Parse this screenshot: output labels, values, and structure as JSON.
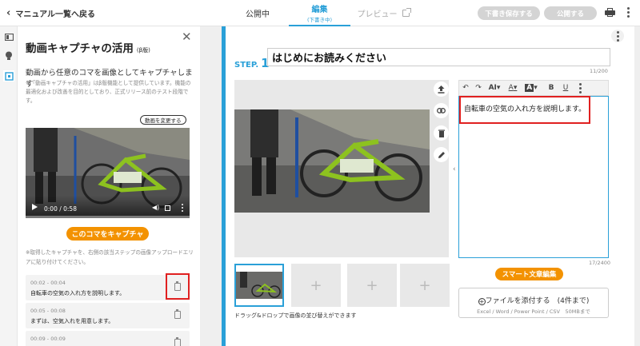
{
  "header": {
    "back_label": "マニュアル一覧へ戻る",
    "tabs": [
      {
        "label": "公開中",
        "sub": ""
      },
      {
        "label": "編集",
        "sub": "(下書き中)"
      },
      {
        "label": "プレビュー",
        "sub": ""
      }
    ],
    "save_draft_label": "下書き保存する",
    "publish_label": "公開する",
    "icons": [
      "chevron-left-icon",
      "external-link-icon",
      "printer-icon",
      "more-vert-icon"
    ]
  },
  "rail": {
    "icons": [
      "book-icon",
      "lightbulb-icon",
      "capture-icon"
    ]
  },
  "capture_panel": {
    "title": "動画キャプチャの活用",
    "beta": "(β版)",
    "lead": "動画から任意のコマを画像としてキャプチャします",
    "note": "※「動画キャプチャの活用」はβ版機能として提供しています。機能の最適化および改善を目的としており、正式リリース前のテスト段階です。",
    "change_video_label": "動画を変更する",
    "video_time": "0:00 / 0:58",
    "capture_button_label": "このコマをキャプチャ",
    "capture_note": "※取得したキャプチャを、右側の該当ステップの画像アップロードエリアに貼り付けてください。",
    "clips": [
      {
        "time": "00:02 - 00:04",
        "text": "自転車の空気の入れ方を説明します。"
      },
      {
        "time": "00:05 - 00:08",
        "text": "まずは、空気入れを用意します。"
      },
      {
        "time": "00:09 - 00:09",
        "text": ""
      }
    ]
  },
  "step": {
    "label": "STEP.",
    "number": "1",
    "title": "はじめにお読みください",
    "title_count": "11/200",
    "image_tools": [
      "upload-icon",
      "link-icon",
      "trash-icon",
      "pencil-icon"
    ],
    "thumbnails": [
      "selected",
      "+",
      "+",
      "+"
    ],
    "thumb_note": "ドラッグ&ドロップで画像の並び替えができます",
    "editor_toolbar": [
      "undo-icon",
      "redo-icon",
      "AI",
      "A",
      "A",
      "B",
      "U",
      "more-icon"
    ],
    "editor_text": "自転車の空気の入れ方を説明します。",
    "editor_count": "17/2400",
    "smart_edit_label": "スマート文章編集",
    "attach_label": "ファイルを添付する　(4件まで)",
    "attach_sub": "Excel / Word / Power Point / CSV　50MBまで"
  },
  "colors": {
    "accent_blue": "#2aa0d8",
    "accent_orange": "#f39200",
    "highlight_red": "#e02020"
  }
}
